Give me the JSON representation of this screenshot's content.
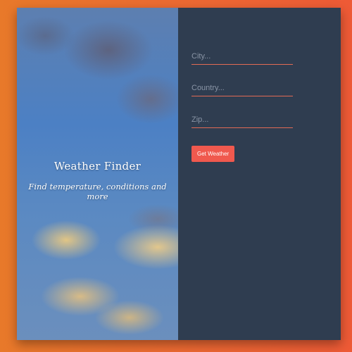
{
  "hero": {
    "title": "Weather Finder",
    "subtitle": "Find temperature, conditions and more"
  },
  "form": {
    "city": {
      "placeholder": "City...",
      "value": ""
    },
    "country": {
      "placeholder": "Country...",
      "value": ""
    },
    "zip": {
      "placeholder": "Zip...",
      "value": ""
    },
    "submit_label": "Get Weather"
  },
  "colors": {
    "background_orange": "#ec6a32",
    "panel": "#2f3d50",
    "accent": "#f0594e",
    "field_underline": "#e26b55"
  }
}
